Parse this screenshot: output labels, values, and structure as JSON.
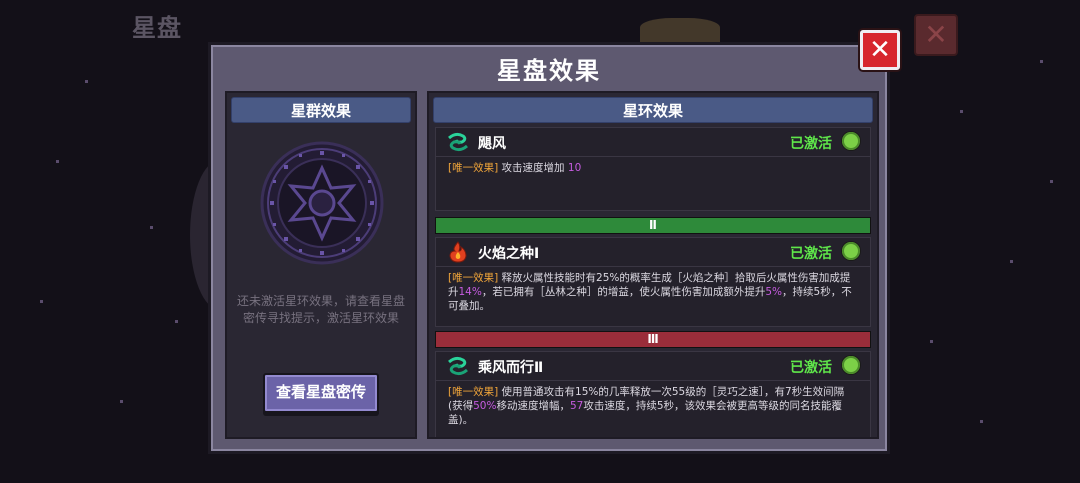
{
  "background": {
    "title": "星盘"
  },
  "modal": {
    "title": "星盘效果",
    "close_icon": "✕"
  },
  "left_panel": {
    "header": "星群效果",
    "hint": "还未激活星环效果，请查看星盘密传寻找提示，激活星环效果",
    "button_label": "查看星盘密传"
  },
  "right_panel": {
    "header": "星环效果",
    "skills": [
      {
        "name": "飓风",
        "status": "已激活",
        "icon": "wind-swirl-icon",
        "desc": [
          {
            "text": "[唯一效果]",
            "style": "tag"
          },
          {
            "text": " 攻击速度增加 ",
            "style": ""
          },
          {
            "text": "10",
            "style": "hl"
          }
        ]
      },
      {
        "name": "火焰之种Ⅰ",
        "status": "已激活",
        "icon": "flame-seed-icon",
        "desc": [
          {
            "text": "[唯一效果]",
            "style": "tag"
          },
          {
            "text": " 释放火属性技能时有25%的概率生成［火焰之种］拾取后火属性伤害加成提升",
            "style": ""
          },
          {
            "text": "14%",
            "style": "hl"
          },
          {
            "text": "，若已拥有［丛林之种］的增益，使火属性伤害加成额外提升",
            "style": ""
          },
          {
            "text": "5%",
            "style": "hl"
          },
          {
            "text": "，持续5秒，不可叠加。",
            "style": ""
          }
        ]
      },
      {
        "name": "乘风而行Ⅱ",
        "status": "已激活",
        "icon": "wind-swirl-icon",
        "desc": [
          {
            "text": "[唯一效果]",
            "style": "tag"
          },
          {
            "text": " 使用普通攻击有15%的几率释放一次55级的［灵巧之速］，有7秒生效间隔(获得",
            "style": ""
          },
          {
            "text": "50%",
            "style": "hl"
          },
          {
            "text": "移动速度增幅，",
            "style": ""
          },
          {
            "text": "57",
            "style": "hl"
          },
          {
            "text": "攻击速度，持续5秒，该效果会被更高等级的同名技能覆盖)。",
            "style": ""
          }
        ]
      }
    ],
    "tiers": [
      "Ⅱ",
      "Ⅲ"
    ]
  },
  "colors": {
    "active_green": "#5fe64a",
    "tag_orange": "#f0a53a",
    "highlight_purple": "#c65ce0",
    "close_red": "#d7262d",
    "tier2_green": "#2e8a3a",
    "tier3_red": "#9a2d3a"
  }
}
